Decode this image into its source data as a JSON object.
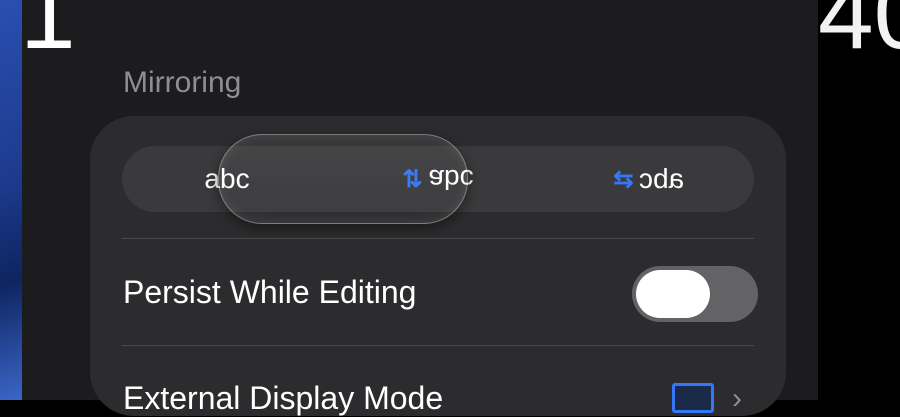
{
  "clock": {
    "left_fragment": "1",
    "right_fragment": "40"
  },
  "section": {
    "title": "Mirroring"
  },
  "segmented_control": {
    "segments": [
      {
        "label": "abc",
        "icon": "none"
      },
      {
        "label": "abc",
        "icon": "flip-vertical-arrows-icon",
        "icon_glyph": "⇅"
      },
      {
        "label": "abc",
        "icon": "flip-horizontal-arrows-icon",
        "icon_glyph": "⇆"
      }
    ],
    "selected_index": 0
  },
  "rows": {
    "persist_while_editing": {
      "label": "Persist While Editing",
      "toggle_on": false
    },
    "external_display_mode": {
      "label": "External Display Mode"
    }
  },
  "colors": {
    "accent": "#3478f6",
    "card": "#2c2c2e",
    "sheet": "#1c1c1e",
    "secondary_text": "#8e8e93"
  }
}
